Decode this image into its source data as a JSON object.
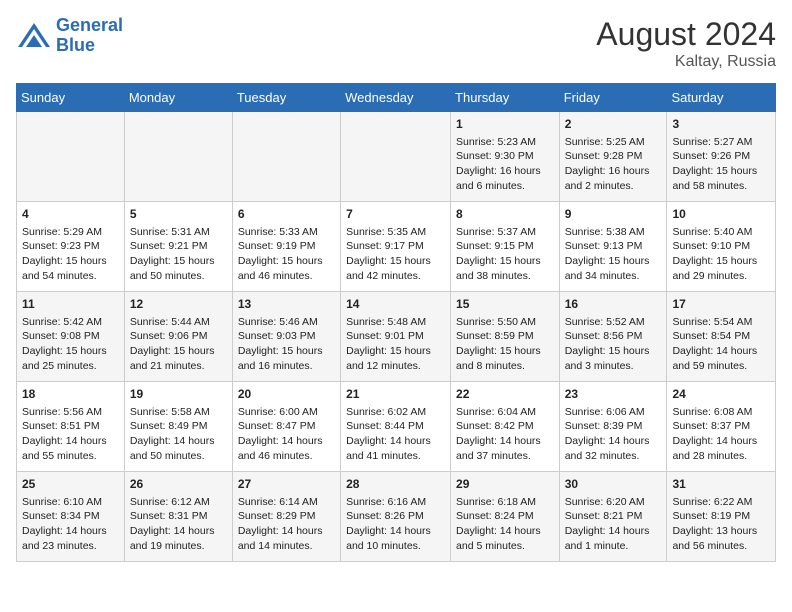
{
  "header": {
    "logo_line1": "General",
    "logo_line2": "Blue",
    "month_year": "August 2024",
    "location": "Kaltay, Russia"
  },
  "days_of_week": [
    "Sunday",
    "Monday",
    "Tuesday",
    "Wednesday",
    "Thursday",
    "Friday",
    "Saturday"
  ],
  "weeks": [
    [
      {
        "day": "",
        "info": ""
      },
      {
        "day": "",
        "info": ""
      },
      {
        "day": "",
        "info": ""
      },
      {
        "day": "",
        "info": ""
      },
      {
        "day": "1",
        "info": "Sunrise: 5:23 AM\nSunset: 9:30 PM\nDaylight: 16 hours\nand 6 minutes."
      },
      {
        "day": "2",
        "info": "Sunrise: 5:25 AM\nSunset: 9:28 PM\nDaylight: 16 hours\nand 2 minutes."
      },
      {
        "day": "3",
        "info": "Sunrise: 5:27 AM\nSunset: 9:26 PM\nDaylight: 15 hours\nand 58 minutes."
      }
    ],
    [
      {
        "day": "4",
        "info": "Sunrise: 5:29 AM\nSunset: 9:23 PM\nDaylight: 15 hours\nand 54 minutes."
      },
      {
        "day": "5",
        "info": "Sunrise: 5:31 AM\nSunset: 9:21 PM\nDaylight: 15 hours\nand 50 minutes."
      },
      {
        "day": "6",
        "info": "Sunrise: 5:33 AM\nSunset: 9:19 PM\nDaylight: 15 hours\nand 46 minutes."
      },
      {
        "day": "7",
        "info": "Sunrise: 5:35 AM\nSunset: 9:17 PM\nDaylight: 15 hours\nand 42 minutes."
      },
      {
        "day": "8",
        "info": "Sunrise: 5:37 AM\nSunset: 9:15 PM\nDaylight: 15 hours\nand 38 minutes."
      },
      {
        "day": "9",
        "info": "Sunrise: 5:38 AM\nSunset: 9:13 PM\nDaylight: 15 hours\nand 34 minutes."
      },
      {
        "day": "10",
        "info": "Sunrise: 5:40 AM\nSunset: 9:10 PM\nDaylight: 15 hours\nand 29 minutes."
      }
    ],
    [
      {
        "day": "11",
        "info": "Sunrise: 5:42 AM\nSunset: 9:08 PM\nDaylight: 15 hours\nand 25 minutes."
      },
      {
        "day": "12",
        "info": "Sunrise: 5:44 AM\nSunset: 9:06 PM\nDaylight: 15 hours\nand 21 minutes."
      },
      {
        "day": "13",
        "info": "Sunrise: 5:46 AM\nSunset: 9:03 PM\nDaylight: 15 hours\nand 16 minutes."
      },
      {
        "day": "14",
        "info": "Sunrise: 5:48 AM\nSunset: 9:01 PM\nDaylight: 15 hours\nand 12 minutes."
      },
      {
        "day": "15",
        "info": "Sunrise: 5:50 AM\nSunset: 8:59 PM\nDaylight: 15 hours\nand 8 minutes."
      },
      {
        "day": "16",
        "info": "Sunrise: 5:52 AM\nSunset: 8:56 PM\nDaylight: 15 hours\nand 3 minutes."
      },
      {
        "day": "17",
        "info": "Sunrise: 5:54 AM\nSunset: 8:54 PM\nDaylight: 14 hours\nand 59 minutes."
      }
    ],
    [
      {
        "day": "18",
        "info": "Sunrise: 5:56 AM\nSunset: 8:51 PM\nDaylight: 14 hours\nand 55 minutes."
      },
      {
        "day": "19",
        "info": "Sunrise: 5:58 AM\nSunset: 8:49 PM\nDaylight: 14 hours\nand 50 minutes."
      },
      {
        "day": "20",
        "info": "Sunrise: 6:00 AM\nSunset: 8:47 PM\nDaylight: 14 hours\nand 46 minutes."
      },
      {
        "day": "21",
        "info": "Sunrise: 6:02 AM\nSunset: 8:44 PM\nDaylight: 14 hours\nand 41 minutes."
      },
      {
        "day": "22",
        "info": "Sunrise: 6:04 AM\nSunset: 8:42 PM\nDaylight: 14 hours\nand 37 minutes."
      },
      {
        "day": "23",
        "info": "Sunrise: 6:06 AM\nSunset: 8:39 PM\nDaylight: 14 hours\nand 32 minutes."
      },
      {
        "day": "24",
        "info": "Sunrise: 6:08 AM\nSunset: 8:37 PM\nDaylight: 14 hours\nand 28 minutes."
      }
    ],
    [
      {
        "day": "25",
        "info": "Sunrise: 6:10 AM\nSunset: 8:34 PM\nDaylight: 14 hours\nand 23 minutes."
      },
      {
        "day": "26",
        "info": "Sunrise: 6:12 AM\nSunset: 8:31 PM\nDaylight: 14 hours\nand 19 minutes."
      },
      {
        "day": "27",
        "info": "Sunrise: 6:14 AM\nSunset: 8:29 PM\nDaylight: 14 hours\nand 14 minutes."
      },
      {
        "day": "28",
        "info": "Sunrise: 6:16 AM\nSunset: 8:26 PM\nDaylight: 14 hours\nand 10 minutes."
      },
      {
        "day": "29",
        "info": "Sunrise: 6:18 AM\nSunset: 8:24 PM\nDaylight: 14 hours\nand 5 minutes."
      },
      {
        "day": "30",
        "info": "Sunrise: 6:20 AM\nSunset: 8:21 PM\nDaylight: 14 hours\nand 1 minute."
      },
      {
        "day": "31",
        "info": "Sunrise: 6:22 AM\nSunset: 8:19 PM\nDaylight: 13 hours\nand 56 minutes."
      }
    ]
  ]
}
